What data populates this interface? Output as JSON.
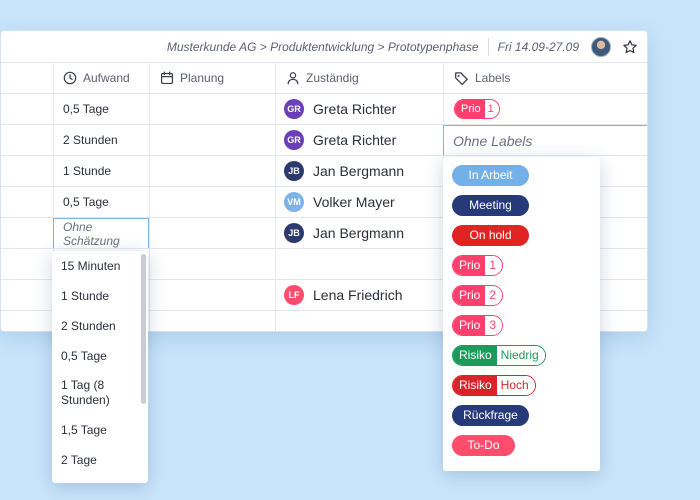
{
  "breadcrumb": {
    "path": "Musterkunde AG > Produktentwicklung > Prototypenphase",
    "date_range": "Fri 14.09-27.09"
  },
  "columns": {
    "effort": "Aufwand",
    "planning": "Planung",
    "assignee": "Zuständig",
    "labels": "Labels"
  },
  "rows": [
    {
      "effort": "0,5 Tage",
      "assignee": {
        "initials": "GR",
        "name": "Greta Richter",
        "color": "#6b3fb5"
      },
      "label": {
        "name": "Prio",
        "value": "1"
      }
    },
    {
      "effort": "2 Stunden",
      "assignee": {
        "initials": "GR",
        "name": "Greta Richter",
        "color": "#6b3fb5"
      },
      "label_placeholder": "Ohne Labels"
    },
    {
      "effort": "1 Stunde",
      "assignee": {
        "initials": "JB",
        "name": "Jan Bergmann",
        "color": "#2d3a6e"
      }
    },
    {
      "effort": "0,5 Tage",
      "assignee": {
        "initials": "VM",
        "name": "Volker Mayer",
        "color": "#7fb3e6"
      }
    },
    {
      "effort_placeholder": "Ohne Schätzung",
      "assignee": {
        "initials": "JB",
        "name": "Jan Bergmann",
        "color": "#2d3a6e"
      }
    },
    {},
    {
      "assignee": {
        "initials": "LF",
        "name": "Lena Friedrich",
        "color": "#ff4d6d"
      }
    },
    {}
  ],
  "estimate_options": [
    "15 Minuten",
    "1 Stunde",
    "2 Stunden",
    "0,5 Tage",
    "1 Tag (8 Stunden)",
    "1,5 Tage",
    "2 Tage"
  ],
  "label_options": [
    {
      "text": "In Arbeit",
      "color": "#74b0e8"
    },
    {
      "text": "Meeting",
      "color": "#263a7a"
    },
    {
      "text": "On hold",
      "color": "#e02424"
    },
    {
      "left": "Prio",
      "right": "1",
      "color": "#ff3f6d"
    },
    {
      "left": "Prio",
      "right": "2",
      "color": "#ff3f6d"
    },
    {
      "left": "Prio",
      "right": "3",
      "color": "#ff3f6d"
    },
    {
      "left": "Risiko",
      "right": "Niedrig",
      "color": "#1c9a5c"
    },
    {
      "left": "Risiko",
      "right": "Hoch",
      "color": "#d8232a"
    },
    {
      "text": "Rückfrage",
      "color": "#263a7a"
    },
    {
      "text": "To-Do",
      "color": "#ff4d6d"
    }
  ],
  "icons": {
    "effort": "clock-icon",
    "planning": "calendar-icon",
    "assignee": "person-icon",
    "labels": "tag-icon",
    "favorite": "star-icon"
  }
}
